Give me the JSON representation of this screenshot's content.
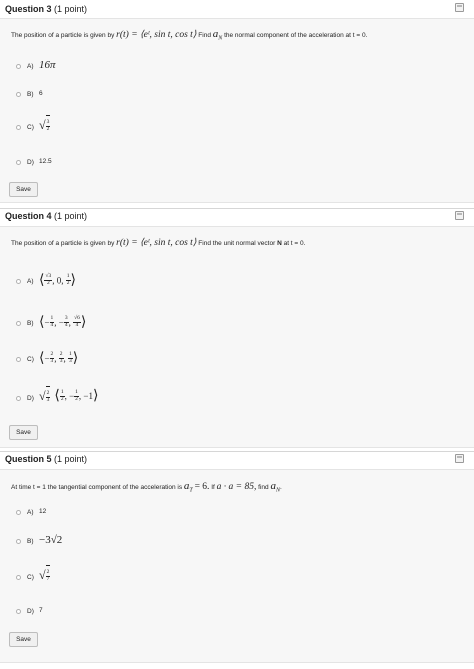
{
  "questions": [
    {
      "number_label": "Question 3",
      "points_label": "(1 point)",
      "prompt_prefix": "The position of a particle is given by",
      "prompt_math": "r(t) = ⟨eᵗ, sin t, cos t⟩",
      "prompt_find": "Find",
      "prompt_target": "a",
      "prompt_target_sub": "N",
      "prompt_suffix": "the normal component of the acceleration at t = 0.",
      "options": [
        {
          "letter": "A)",
          "value": "16π"
        },
        {
          "letter": "B)",
          "value": "6"
        },
        {
          "letter": "C)",
          "value_radical": "√",
          "value_num": "3",
          "value_den": "2"
        },
        {
          "letter": "D)",
          "value": "12.5"
        }
      ],
      "save_label": "Save"
    },
    {
      "number_label": "Question 4",
      "points_label": "(1 point)",
      "prompt_prefix": "The position of a particle is given by",
      "prompt_math": "r(t) = ⟨eᵗ, sin t, cos t⟩",
      "prompt_suffix_pre": "Find the unit normal vector",
      "prompt_bold": "N",
      "prompt_suffix_post": "at t = 0.",
      "options": [
        {
          "letter": "A)",
          "parts": [
            "√3 / 2",
            "0",
            "1 / 2"
          ]
        },
        {
          "letter": "B)",
          "parts": [
            "−1 / 4",
            "−3 / 4",
            "√6 / 4"
          ]
        },
        {
          "letter": "C)",
          "parts": [
            "−2 / 3",
            "2 / 3",
            "1 / 3"
          ]
        },
        {
          "letter": "D)",
          "prefix": "√(2/3)",
          "parts": [
            "1 / 2",
            "−1 / 2",
            "−1"
          ]
        }
      ],
      "save_label": "Save"
    },
    {
      "number_label": "Question 5",
      "points_label": "(1 point)",
      "prompt_prefix": "At time t = 1 the tangential component of the acceleration is",
      "prompt_math1": "a",
      "prompt_math1_sub": "T",
      "prompt_math1_val": "= 6.",
      "prompt_if": "If",
      "prompt_math2": "a · a = 85,",
      "prompt_find": "find",
      "prompt_target": "a",
      "prompt_target_sub": "N",
      "prompt_end": ".",
      "options": [
        {
          "letter": "A)",
          "value": "12"
        },
        {
          "letter": "B)",
          "value": "−3√2"
        },
        {
          "letter": "C)",
          "value_radical": "√",
          "value_num": "2",
          "value_den": "7"
        },
        {
          "letter": "D)",
          "value": "7"
        }
      ],
      "save_label": "Save"
    }
  ],
  "icons": {
    "save_state": "floppy-disk-icon",
    "radio": "radio-button-unselected"
  }
}
